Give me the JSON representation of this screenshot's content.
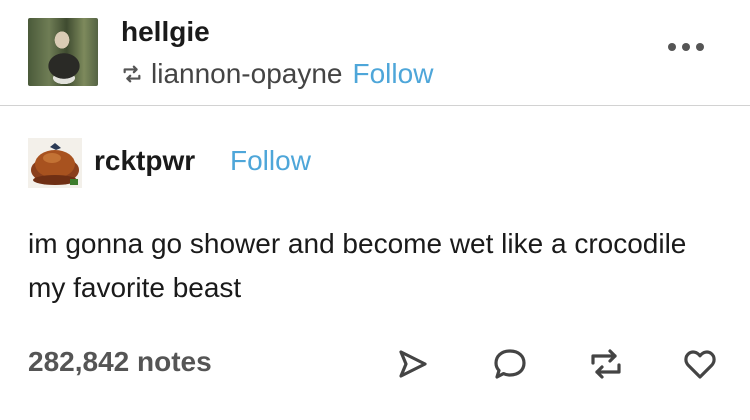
{
  "reblog": {
    "user": "hellgie",
    "via_user": "liannon-opayne",
    "follow_label": "Follow"
  },
  "post": {
    "author": "rcktpwr",
    "follow_label": "Follow",
    "text": "im gonna go shower and become wet like a crocodile my favorite beast",
    "notes": "282,842 notes"
  },
  "icons": {
    "menu": "more-icon",
    "reblog_mini": "reblog-icon",
    "share": "send-icon",
    "reply": "comment-icon",
    "reblog": "reblog-icon",
    "like": "heart-icon"
  },
  "colors": {
    "follow": "#4ea6d9",
    "text": "#1a1a1a",
    "notes": "#555555",
    "divider": "#d2d2d2"
  }
}
